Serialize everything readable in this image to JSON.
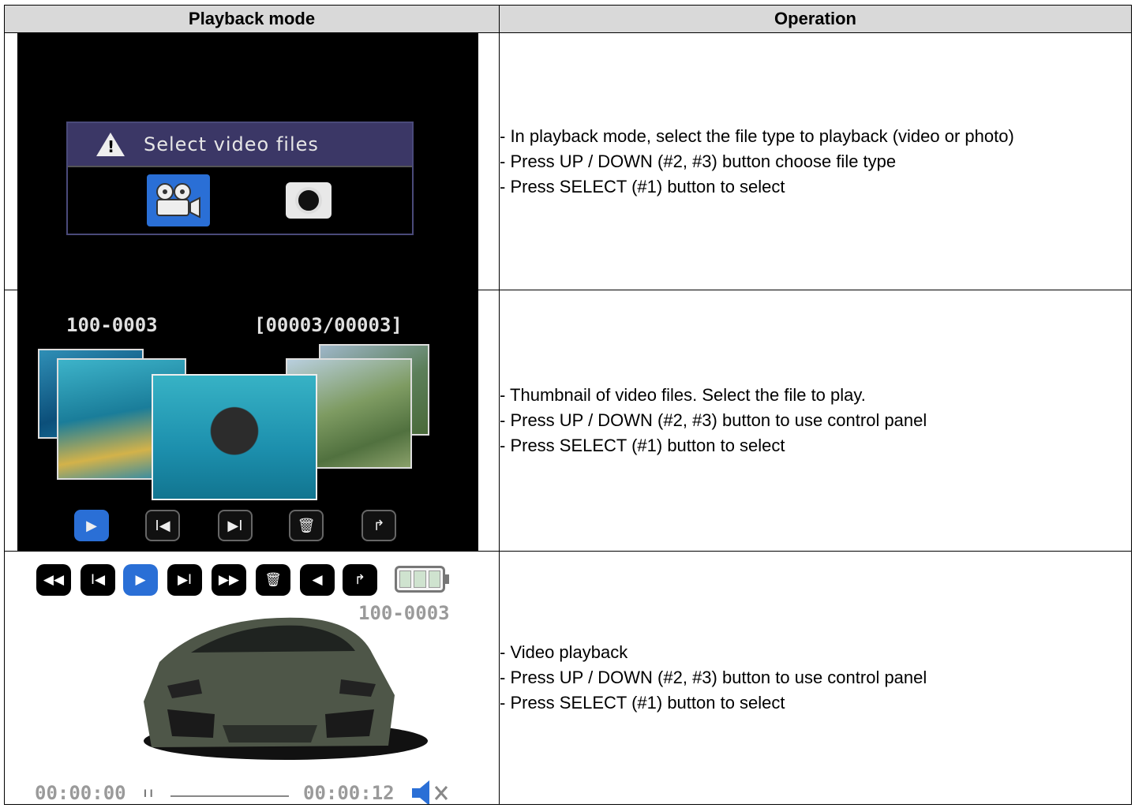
{
  "header": {
    "col1": "Playback mode",
    "col2": "Operation"
  },
  "rows": [
    {
      "screen": {
        "dialog_title": "Select video files",
        "icons": [
          "warning-icon",
          "video-camera-icon",
          "photo-camera-icon"
        ],
        "selected_icon": "video-camera-icon"
      },
      "ops": [
        "- In playback mode, select the file type to playback (video or photo)",
        "- Press UP / DOWN (#2, #3) button choose file type",
        "- Press SELECT (#1) button to select"
      ]
    },
    {
      "screen": {
        "file_name": "100-0003",
        "counter": "[00003/00003]",
        "controls": [
          "play-icon",
          "previous-icon",
          "next-icon",
          "delete-icon",
          "return-icon"
        ],
        "selected_control": "play-icon"
      },
      "ops": [
        "- Thumbnail of video files. Select the file to play.",
        "- Press UP / DOWN (#2, #3) button to use control panel",
        "- Press SELECT (#1) button to select"
      ]
    },
    {
      "screen": {
        "file_name": "100-0003",
        "elapsed": "00:00:00",
        "total": "00:00:12",
        "toolbar": [
          "rewind-icon",
          "previous-icon",
          "play-icon",
          "next-icon",
          "fast-forward-icon",
          "delete-icon",
          "volume-icon",
          "return-icon"
        ],
        "selected_tool": "play-icon",
        "battery_level": "full"
      },
      "ops": [
        "- Video playback",
        "- Press UP / DOWN (#2, #3) button to use control panel",
        "- Press SELECT (#1) button to select"
      ]
    }
  ],
  "colors": {
    "header_bg": "#d9d9d9",
    "selection_blue": "#2a6fd6",
    "dialog_header": "#3b3766"
  }
}
